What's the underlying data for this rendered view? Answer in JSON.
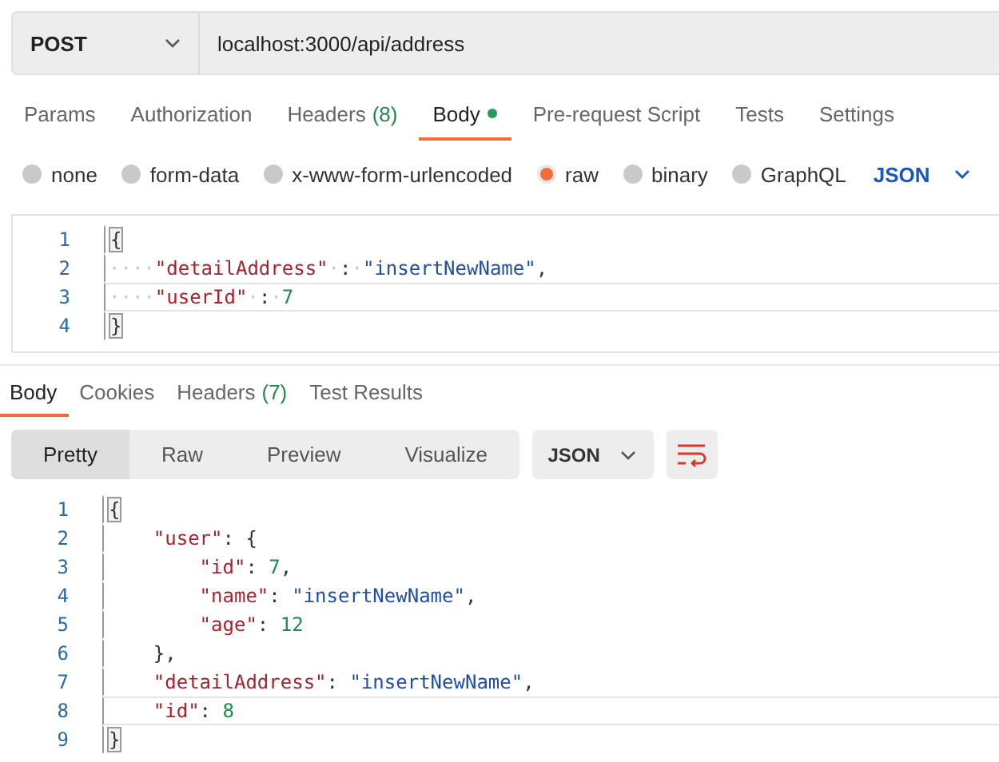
{
  "request": {
    "method": "POST",
    "url": "localhost:3000/api/address"
  },
  "request_tabs": [
    {
      "label": "Params",
      "selected": false
    },
    {
      "label": "Authorization",
      "selected": false
    },
    {
      "label": "Headers",
      "count": "(8)",
      "selected": false
    },
    {
      "label": "Body",
      "dot": true,
      "selected": true
    },
    {
      "label": "Pre-request Script",
      "selected": false
    },
    {
      "label": "Tests",
      "selected": false
    },
    {
      "label": "Settings",
      "selected": false
    }
  ],
  "body_types": [
    {
      "label": "none",
      "selected": false
    },
    {
      "label": "form-data",
      "selected": false
    },
    {
      "label": "x-www-form-urlencoded",
      "selected": false
    },
    {
      "label": "raw",
      "selected": true
    },
    {
      "label": "binary",
      "selected": false
    },
    {
      "label": "GraphQL",
      "selected": false
    }
  ],
  "body_format": "JSON",
  "request_body": [
    {
      "number": "1",
      "current": false,
      "tokens": [
        {
          "kind": "brace",
          "text": "{"
        }
      ]
    },
    {
      "number": "2",
      "current": false,
      "tokens": [
        {
          "kind": "ws",
          "text": "····"
        },
        {
          "kind": "key",
          "text": "\"detailAddress\""
        },
        {
          "kind": "ws",
          "text": "·"
        },
        {
          "kind": "punct",
          "text": ":"
        },
        {
          "kind": "ws",
          "text": "·"
        },
        {
          "kind": "str",
          "text": "\"insertNewName\""
        },
        {
          "kind": "punct",
          "text": ","
        }
      ]
    },
    {
      "number": "3",
      "current": true,
      "tokens": [
        {
          "kind": "ws",
          "text": "····"
        },
        {
          "kind": "key",
          "text": "\"userId\""
        },
        {
          "kind": "ws",
          "text": "·"
        },
        {
          "kind": "punct",
          "text": ":"
        },
        {
          "kind": "ws",
          "text": "·"
        },
        {
          "kind": "num",
          "text": "7"
        }
      ]
    },
    {
      "number": "4",
      "current": false,
      "tokens": [
        {
          "kind": "brace",
          "text": "}"
        }
      ]
    }
  ],
  "response_tabs": [
    {
      "label": "Body",
      "selected": true
    },
    {
      "label": "Cookies",
      "selected": false
    },
    {
      "label": "Headers",
      "count": "(7)",
      "selected": false
    },
    {
      "label": "Test Results",
      "selected": false
    }
  ],
  "view_modes": [
    {
      "label": "Pretty",
      "selected": true
    },
    {
      "label": "Raw",
      "selected": false
    },
    {
      "label": "Preview",
      "selected": false
    },
    {
      "label": "Visualize",
      "selected": false
    }
  ],
  "response_format": "JSON",
  "response_body": [
    {
      "number": "1",
      "current": false,
      "tokens": [
        {
          "kind": "brace",
          "text": "{"
        }
      ]
    },
    {
      "number": "2",
      "current": false,
      "tokens": [
        {
          "kind": "key",
          "text": "    \"user\""
        },
        {
          "kind": "punct",
          "text": ": {"
        }
      ]
    },
    {
      "number": "3",
      "current": false,
      "tokens": [
        {
          "kind": "key",
          "text": "        \"id\""
        },
        {
          "kind": "punct",
          "text": ": "
        },
        {
          "kind": "num",
          "text": "7"
        },
        {
          "kind": "punct",
          "text": ","
        }
      ]
    },
    {
      "number": "4",
      "current": false,
      "tokens": [
        {
          "kind": "key",
          "text": "        \"name\""
        },
        {
          "kind": "punct",
          "text": ": "
        },
        {
          "kind": "str",
          "text": "\"insertNewName\""
        },
        {
          "kind": "punct",
          "text": ","
        }
      ]
    },
    {
      "number": "5",
      "current": false,
      "tokens": [
        {
          "kind": "key",
          "text": "        \"age\""
        },
        {
          "kind": "punct",
          "text": ": "
        },
        {
          "kind": "num",
          "text": "12"
        }
      ]
    },
    {
      "number": "6",
      "current": false,
      "tokens": [
        {
          "kind": "punct",
          "text": "    },"
        }
      ]
    },
    {
      "number": "7",
      "current": false,
      "tokens": [
        {
          "kind": "key",
          "text": "    \"detailAddress\""
        },
        {
          "kind": "punct",
          "text": ": "
        },
        {
          "kind": "str",
          "text": "\"insertNewName\""
        },
        {
          "kind": "punct",
          "text": ","
        }
      ]
    },
    {
      "number": "8",
      "current": true,
      "tokens": [
        {
          "kind": "key",
          "text": "    \"id\""
        },
        {
          "kind": "punct",
          "text": ": "
        },
        {
          "kind": "num",
          "text": "8"
        }
      ]
    },
    {
      "number": "9",
      "current": false,
      "tokens": [
        {
          "kind": "brace",
          "text": "}"
        }
      ]
    }
  ]
}
